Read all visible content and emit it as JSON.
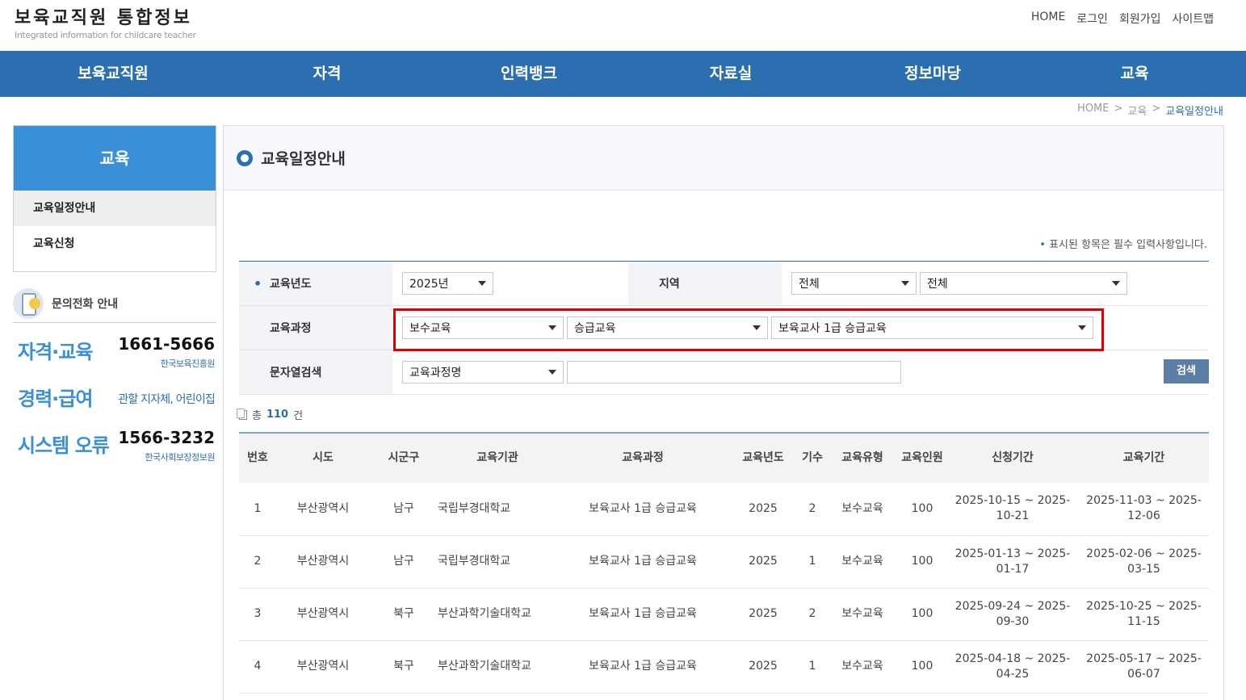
{
  "site": {
    "title": "보육교직원 통합정보",
    "subtitle": "Integrated information for childcare teacher"
  },
  "top_links": [
    "HOME",
    "로그인",
    "회원가입",
    "사이트맵"
  ],
  "gnb": [
    "보육교직원",
    "자격",
    "인력뱅크",
    "자료실",
    "정보마당",
    "교육"
  ],
  "breadcrumb": {
    "home": "HOME",
    "sep1": ">",
    "section": "교육",
    "sep2": ">",
    "current": "교육일정안내"
  },
  "lnb": {
    "title": "교육",
    "items": [
      "교육일정안내",
      "교육신청"
    ]
  },
  "contact": {
    "heading": "문의전화 안내",
    "rows": [
      {
        "category": "자격·교육",
        "number": "1661-5666",
        "org": "한국보육진흥원"
      },
      {
        "category": "경력·급여",
        "number": "",
        "org": "관할 지자체, 어린이집"
      },
      {
        "category": "시스템 오류",
        "number": "1566-3232",
        "org": "한국사회보장정보원"
      }
    ]
  },
  "page_title": "교육일정안내",
  "required_note": "표시된 항목은 필수 입력사항입니다.",
  "required_dot": "•",
  "search": {
    "year_label": "교육년도",
    "year_value": "2025년",
    "region_label": "지역",
    "region_sido": "전체",
    "region_sigungu": "전체",
    "course_label": "교육과정",
    "course_1": "보수교육",
    "course_2": "승급교육",
    "course_3": "보육교사 1급 승급교육",
    "keyword_label": "문자열검색",
    "keyword_type": "교육과정명",
    "keyword_value": "",
    "search_button": "검색"
  },
  "total": {
    "prefix": "총",
    "count": "110",
    "suffix": "건"
  },
  "table": {
    "headers": [
      "번호",
      "시도",
      "시군구",
      "교육기관",
      "교육과정",
      "교육년도",
      "기수",
      "교육유형",
      "교육인원",
      "신청기간",
      "교육기간"
    ],
    "rows": [
      [
        "1",
        "부산광역시",
        "남구",
        "국립부경대학교",
        "보육교사 1급 승급교육",
        "2025",
        "2",
        "보수교육",
        "100",
        "2025-10-15 ~ 2025-10-21",
        "2025-11-03 ~ 2025-12-06"
      ],
      [
        "2",
        "부산광역시",
        "남구",
        "국립부경대학교",
        "보육교사 1급 승급교육",
        "2025",
        "1",
        "보수교육",
        "100",
        "2025-01-13 ~ 2025-01-17",
        "2025-02-06 ~ 2025-03-15"
      ],
      [
        "3",
        "부산광역시",
        "북구",
        "부산과학기술대학교",
        "보육교사 1급 승급교육",
        "2025",
        "2",
        "보수교육",
        "100",
        "2025-09-24 ~ 2025-09-30",
        "2025-10-25 ~ 2025-11-15"
      ],
      [
        "4",
        "부산광역시",
        "북구",
        "부산과학기술대학교",
        "보육교사 1급 승급교육",
        "2025",
        "1",
        "보수교육",
        "100",
        "2025-04-18 ~ 2025-04-25",
        "2025-05-17 ~ 2025-06-07"
      ]
    ]
  },
  "colors": {
    "brand": "#2b6fb0",
    "lnb_title": "#3a8fd9",
    "highlight": "#e00000"
  }
}
